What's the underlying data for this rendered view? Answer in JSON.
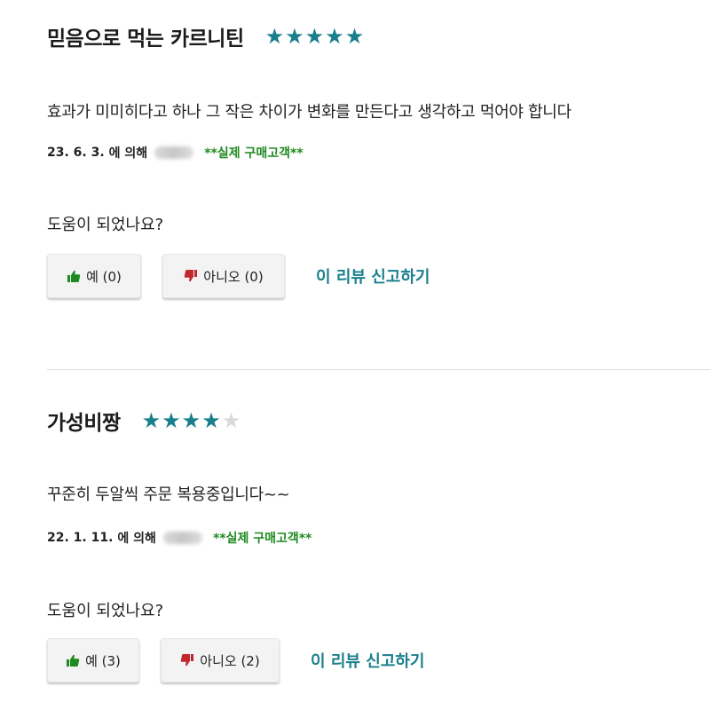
{
  "reviews": [
    {
      "title": "믿음으로 먹는 카르니틴",
      "rating": 5,
      "max_rating": 5,
      "body": "효과가 미미히다고 하나 그 작은 차이가 변화를 만든다고 생각하고 먹어야 합니다",
      "date": "23. 6. 3.",
      "by_label": "에 의해",
      "verified_label": "**실제 구매고객**",
      "helpful_question": "도움이 되었나요?",
      "yes_label": "예 (0)",
      "no_label": "아니오 (0)",
      "report_label": "이 리뷰 신고하기"
    },
    {
      "title": "가성비짱",
      "rating": 4,
      "max_rating": 5,
      "body": "꾸준히 두알씩 주문 복용중입니다~~",
      "date": "22. 1. 11.",
      "by_label": "에 의해",
      "verified_label": "**실제 구매고객**",
      "helpful_question": "도움이 되었나요?",
      "yes_label": "예 (3)",
      "no_label": "아니오 (2)",
      "report_label": "이 리뷰 신고하기"
    }
  ],
  "icons": {
    "star": "star-icon",
    "thumbs_up": "thumbs-up-icon",
    "thumbs_down": "thumbs-down-icon"
  },
  "colors": {
    "accent": "#1a7f8c",
    "star_off": "#d9d9d9",
    "verified": "#1f8a1f",
    "thumbs_up": "#1f8a1f",
    "thumbs_down": "#c0282d",
    "button_bg": "#f3f3f3",
    "divider": "#dddddd"
  }
}
